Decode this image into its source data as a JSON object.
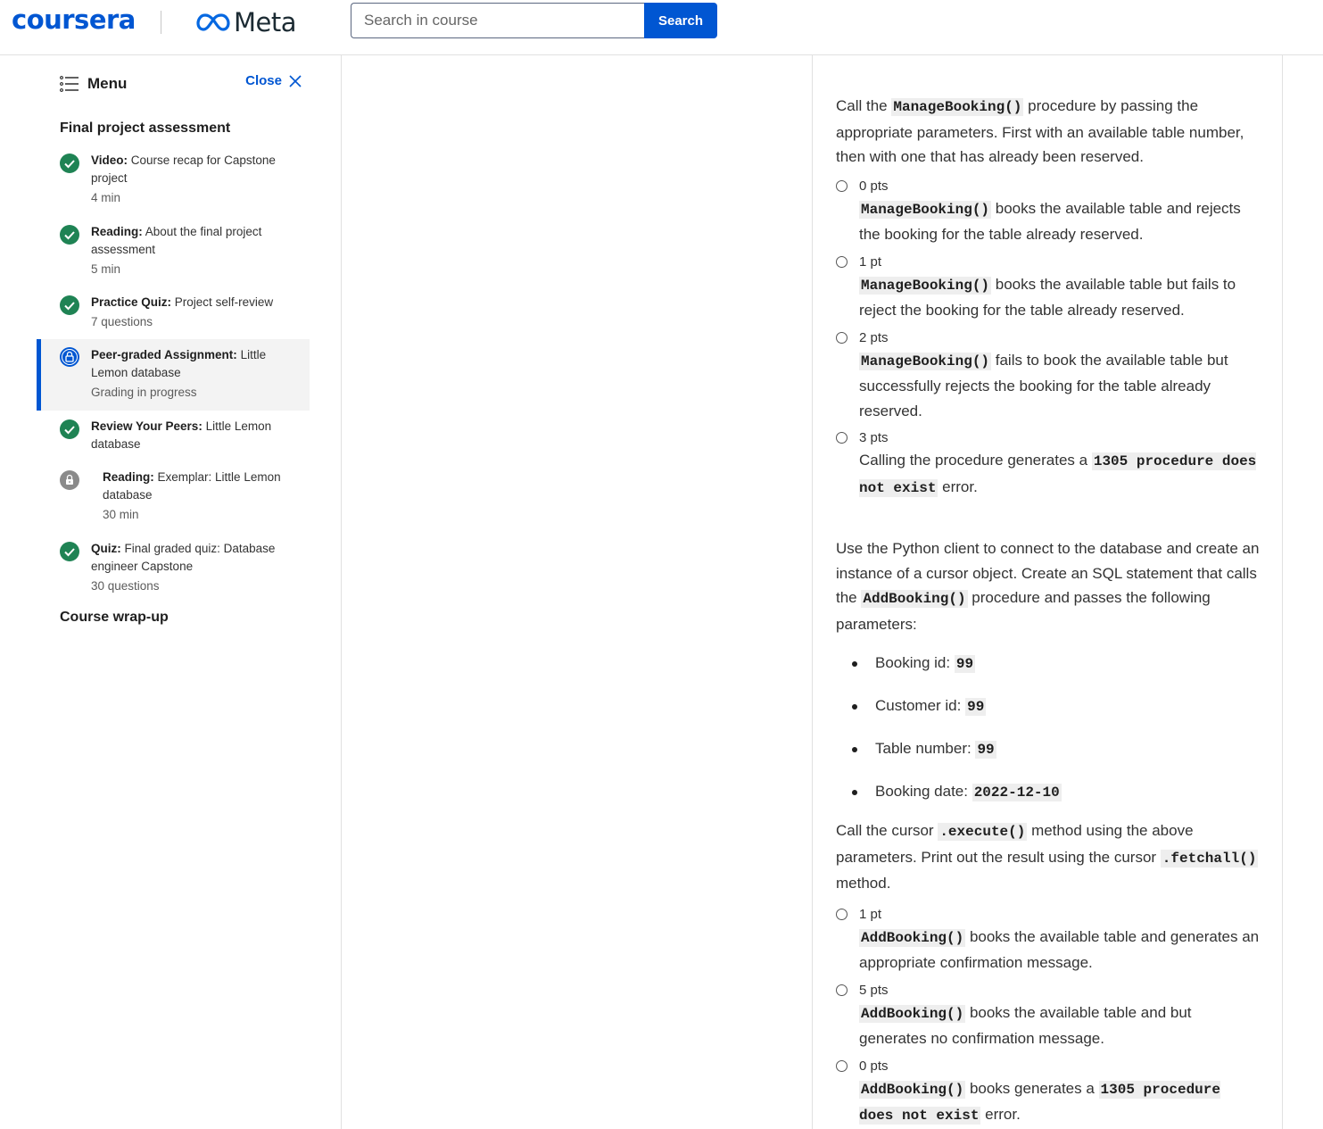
{
  "header": {
    "logo_coursera": "coursera",
    "logo_meta": "Meta",
    "search_placeholder": "Search in course",
    "search_button": "Search",
    "brand_color": "#0056d2"
  },
  "sidebar": {
    "menu_label": "Menu",
    "close_label": "Close",
    "section_title": "Final project assessment",
    "items": [
      {
        "type": "Video:",
        "title": "Course recap for Capstone project",
        "meta": "4 min",
        "status": "completed"
      },
      {
        "type": "Reading:",
        "title": "About the final project assessment",
        "meta": "5 min",
        "status": "completed"
      },
      {
        "type": "Practice Quiz:",
        "title": "Project self-review",
        "meta": "7 questions",
        "status": "completed"
      },
      {
        "type": "Peer-graded Assignment:",
        "title": "Little Lemon database",
        "meta": "Grading in progress",
        "status": "in-progress"
      },
      {
        "type": "Review Your Peers:",
        "title": "Little Lemon database",
        "meta": "",
        "status": "completed"
      },
      {
        "type": "Reading:",
        "title": "Exemplar: Little Lemon database",
        "meta": "30 min",
        "status": "locked"
      },
      {
        "type": "Quiz:",
        "title": "Final graded quiz: Database engineer Capstone",
        "meta": "30 questions",
        "status": "completed"
      }
    ],
    "section_title_2": "Course wrap-up"
  },
  "question1": {
    "pre": "Call the ",
    "code": "ManageBooking()",
    "post": " procedure by passing the appropriate parameters. First with an available table number, then with one that has already been reserved.",
    "options": [
      {
        "pts": "0 pts",
        "code": "ManageBooking()",
        "text": " books the available table and rejects the booking for the table already reserved."
      },
      {
        "pts": "1 pt",
        "code": "ManageBooking()",
        "text": " books the available table but fails to reject the booking for the table already reserved."
      },
      {
        "pts": "2 pts",
        "code": "ManageBooking()",
        "text": " fails to book the available table but successfully rejects the booking for the table already reserved."
      }
    ],
    "option4": {
      "pts": "3 pts",
      "pre": "Calling the procedure generates a ",
      "code": "1305 procedure does not exist",
      "post": " error."
    }
  },
  "question2": {
    "pre": "Use the Python client to connect to the database and create an instance of a cursor object. Create an SQL statement that calls the ",
    "code": "AddBooking()",
    "post": " procedure and passes the following parameters:",
    "params": [
      {
        "label": "Booking id: ",
        "value": "99"
      },
      {
        "label": "Customer id: ",
        "value": "99"
      },
      {
        "label": "Table number: ",
        "value": "99"
      },
      {
        "label": "Booking date: ",
        "value": "2022-12-10"
      }
    ],
    "p2_a": "Call the cursor ",
    "p2_code1": ".execute()",
    "p2_b": " method using the above parameters. Print out the result using the cursor ",
    "p2_code2": ".fetchall()",
    "p2_c": " method.",
    "options": [
      {
        "pts": "1 pt",
        "code": "AddBooking()",
        "text": " books the available table and generates an appropriate confirmation message."
      },
      {
        "pts": "5 pts",
        "code": "AddBooking()",
        "text": " books the available table and but generates no confirmation message."
      }
    ],
    "option3": {
      "pts": "0 pts",
      "code": "AddBooking()",
      "pre": " books generates a ",
      "code2": "1305 procedure does not exist",
      "post": " error."
    }
  }
}
